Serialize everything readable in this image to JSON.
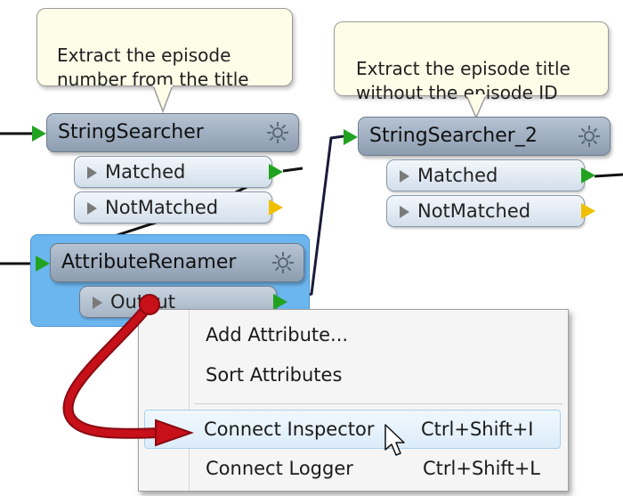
{
  "annotations": [
    {
      "text": "Extract the episode\nnumber from the title"
    },
    {
      "text": "Extract the episode title\nwithout the episode ID"
    }
  ],
  "transformers": {
    "stringsearcher": {
      "name": "StringSearcher",
      "ports": [
        "Matched",
        "NotMatched"
      ]
    },
    "stringsearcher_2": {
      "name": "StringSearcher_2",
      "ports": [
        "Matched",
        "NotMatched"
      ]
    },
    "attributerenamer": {
      "name": "AttributeRenamer",
      "ports": [
        "Output"
      ]
    }
  },
  "context_menu": {
    "items": [
      {
        "label": "Add Attribute...",
        "shortcut": ""
      },
      {
        "label": "Sort Attributes",
        "shortcut": ""
      },
      {
        "label": "Connect Inspector",
        "shortcut": "Ctrl+Shift+I",
        "highlighted": true
      },
      {
        "label": "Connect Logger",
        "shortcut": "Ctrl+Shift+L"
      }
    ]
  },
  "colors": {
    "accent_selection": "#6cb6ef",
    "connection_green": "#21a321",
    "notmatched_yellow": "#f0c000",
    "callout_arrow_red": "#c8101a"
  },
  "icons": [
    "gear-icon",
    "input-port-arrow-icon",
    "output-port-arrow-icon",
    "mouse-cursor-icon",
    "red-callout-arrow-icon"
  ]
}
